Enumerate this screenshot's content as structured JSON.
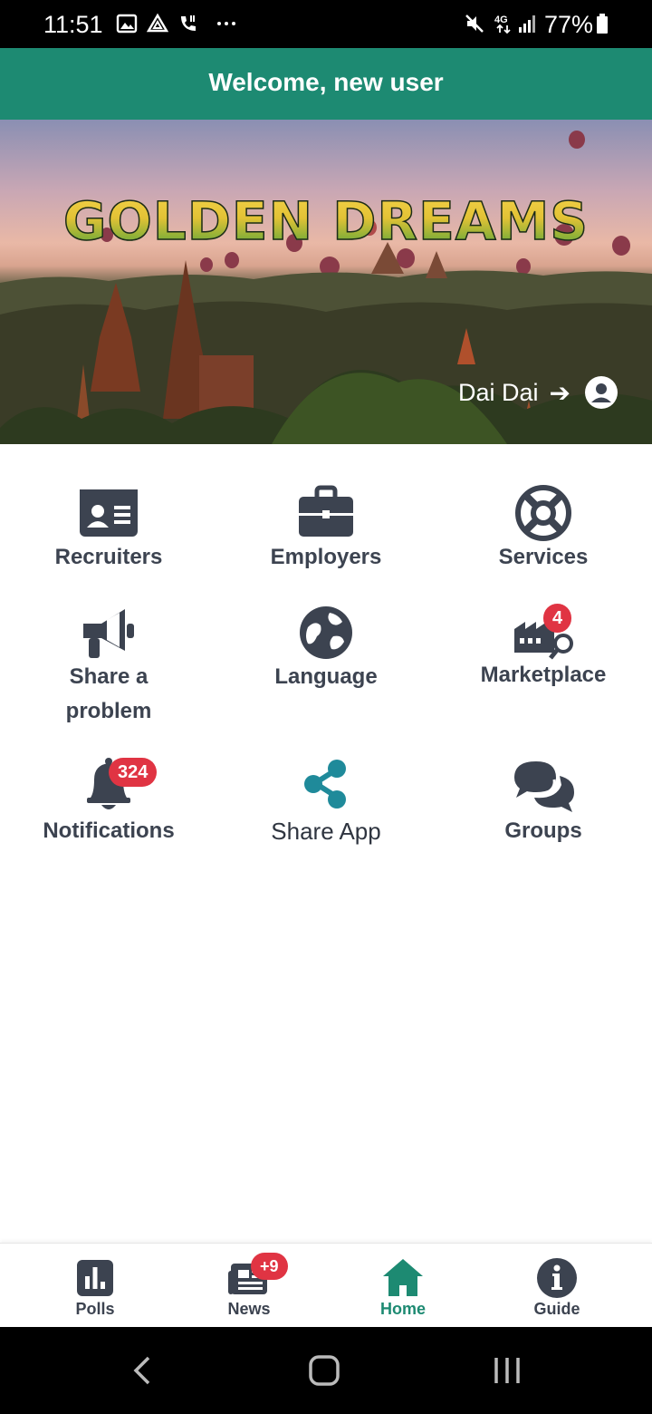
{
  "status_bar": {
    "time": "11:51",
    "left_icons": [
      "image-icon",
      "drive-icon",
      "wifi-call-icon",
      "more-dots-icon"
    ],
    "right_icons": [
      "mute-icon",
      "4g-icon",
      "signal-icon",
      "battery-icon"
    ],
    "battery": "77%",
    "network": "4G"
  },
  "header": {
    "title": "Welcome, new user"
  },
  "banner": {
    "brand": "GOLDEN DREAMS",
    "user_name": "Dai Dai"
  },
  "tiles": [
    {
      "label": "Recruiters",
      "icon": "id-card-icon"
    },
    {
      "label": "Employers",
      "icon": "briefcase-icon"
    },
    {
      "label": "Services",
      "icon": "life-ring-icon"
    },
    {
      "label_line1": "Share a",
      "label_line2": "problem",
      "icon": "megaphone-icon"
    },
    {
      "label": "Language",
      "icon": "globe-icon"
    },
    {
      "label": "Marketplace",
      "icon": "factory-search-icon",
      "badge": "4"
    },
    {
      "label": "Notifications",
      "icon": "bell-icon",
      "badge": "324"
    },
    {
      "label": "Share App",
      "icon": "share-icon"
    },
    {
      "label": "Groups",
      "icon": "chat-bubbles-icon"
    }
  ],
  "bottom_nav": [
    {
      "label": "Polls",
      "icon": "poll-icon"
    },
    {
      "label": "News",
      "icon": "newspaper-icon",
      "badge": "+9"
    },
    {
      "label": "Home",
      "icon": "home-icon",
      "active": true
    },
    {
      "label": "Guide",
      "icon": "info-icon"
    }
  ],
  "colors": {
    "primary": "#1d8a72",
    "icon": "#3c4350",
    "badge": "#e03443",
    "share": "#1f8a9a"
  }
}
